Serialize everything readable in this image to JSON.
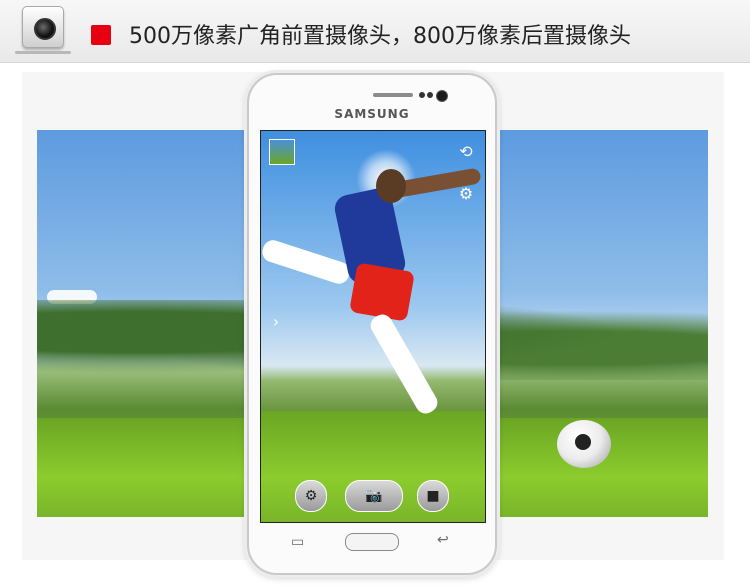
{
  "header": {
    "title": "500万像素广角前置摄像头，800万像素后置摄像头",
    "accent": "#e60012",
    "icon": "camera-badge-icon"
  },
  "phone": {
    "brand": "SAMSUNG",
    "body_color": "#fbfbfb"
  },
  "camera_ui": {
    "icons": [
      "gallery-thumbnail-icon",
      "flip-camera-icon",
      "settings-icon",
      "expand-chevron-icon",
      "mode-icon",
      "shutter-camera-icon",
      "video-record-icon"
    ]
  },
  "hardware_keys": {
    "icons": [
      "recent-apps-icon",
      "home-button",
      "back-icon"
    ]
  },
  "colors": {
    "sky": "#5d9bdf",
    "grass": "#8ccc2d",
    "jersey": "#1f3a9a",
    "shorts": "#e2231a"
  }
}
